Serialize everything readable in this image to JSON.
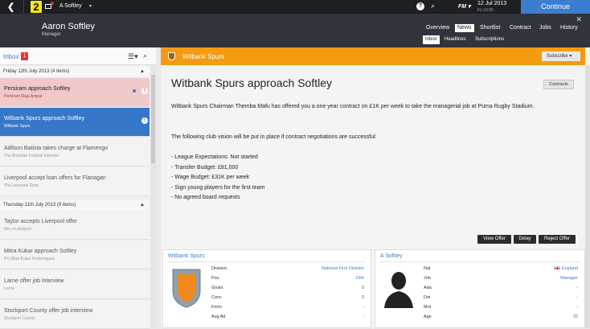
{
  "topbar": {
    "back": "❮",
    "badge": "2",
    "profile": "A Softley",
    "fm_label": "FM",
    "date_main": "12 Jul 2013",
    "date_sub": "Fri 10:55",
    "continue_label": "Continue"
  },
  "header": {
    "name": "Aaron Softley",
    "role": "Manager",
    "nav": [
      "Overview",
      "News",
      "Shortlist",
      "Contract",
      "Jobs",
      "History"
    ],
    "active_nav": "News",
    "subtabs": [
      "Inbox",
      "Headlines",
      "Subscriptions"
    ],
    "active_subtab": "Inbox"
  },
  "inbox": {
    "label": "Inbox",
    "count": "1",
    "groups": [
      {
        "date": "Friday 12th July 2013 (4 items)",
        "items": [
          {
            "title": "Persiram approach Softley",
            "sub": "Persiram Raja Ampat",
            "state": "unread-red"
          },
          {
            "title": "Witbank Spurs approach Softley",
            "sub": "Witbank Spurs",
            "state": "selected"
          },
          {
            "title": "Adilson Batista takes charge at Flamengo",
            "sub": "The Brazilian Football Informer",
            "state": "read"
          },
          {
            "title": "Liverpool accept loan offers for Flanagan",
            "sub": "The Liverpool Echo",
            "state": "read"
          }
        ]
      },
      {
        "date": "Thursday 11th July 2013 (9 items)",
        "items": [
          {
            "title": "Taylor accepts Liverpool offer",
            "sub": "bbc.co.uk/sport",
            "state": "read"
          },
          {
            "title": "Mitra Kukar approach Softley",
            "sub": "PS Mitra Kukar Kertanegara",
            "state": "read"
          },
          {
            "title": "Larne offer job interview",
            "sub": "Larne",
            "state": "read"
          },
          {
            "title": "Stockport County offer job interview",
            "sub": "Stockport County",
            "state": "read"
          }
        ]
      }
    ]
  },
  "message": {
    "club": "Witbank Spurs",
    "subscribe": "Subscribe",
    "headline": "Witbank Spurs approach Softley",
    "contracts_button": "Contracts",
    "p1": "Witbank Spurs Chairman Themba Mafu has offered you a one year contract on £1K per week to take the managerial job at Puma Rugby Stadium.",
    "p2": "The following club vision will be put in place if contract negotiations are successful:",
    "vision": [
      "- League Expectations: Not started",
      "- Transfer Budget: £81,000",
      "- Wage Budget: £31K per week",
      "- Sign young players for the first team",
      "- No agreed board requests"
    ],
    "actions": [
      "View Offer",
      "Delay",
      "Reject Offer"
    ]
  },
  "club_card": {
    "title": "Witbank Spurs",
    "rows": [
      {
        "k": "Division",
        "v": "National First Division",
        "link": true
      },
      {
        "k": "Pos",
        "v": "16th",
        "link": true
      },
      {
        "k": "Goals",
        "v": "0",
        "link": false
      },
      {
        "k": "Conc",
        "v": "0",
        "link": false
      },
      {
        "k": "Form",
        "v": "-",
        "link": false
      },
      {
        "k": "Avg Att",
        "v": "-",
        "link": false
      }
    ]
  },
  "person_card": {
    "title": "A Softley",
    "rows": [
      {
        "k": "Nat",
        "v": "England",
        "link": true,
        "flag": true
      },
      {
        "k": "Job",
        "v": "Manager",
        "link": true
      },
      {
        "k": "Ada",
        "v": "-",
        "link": false
      },
      {
        "k": "Det",
        "v": "-",
        "link": false
      },
      {
        "k": "Mot",
        "v": "-",
        "link": false
      },
      {
        "k": "Age",
        "v": "25",
        "link": true
      }
    ]
  },
  "colors": {
    "accent_blue": "#3b7ed1",
    "orange_bar": "#f49b12",
    "unread_red": "#f0c8c8",
    "header_dark": "#31343b"
  }
}
